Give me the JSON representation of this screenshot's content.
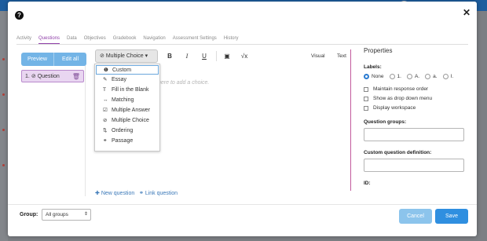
{
  "modal": {
    "tabs": [
      "Activity",
      "Questions",
      "Data",
      "Objectives",
      "Gradebook",
      "Navigation",
      "Assessment Settings",
      "History"
    ],
    "active_tab": "Questions"
  },
  "left": {
    "preview_label": "Preview",
    "edit_all_label": "Edit all",
    "question_item": "1.",
    "question_label": "Question"
  },
  "editor": {
    "type_select": "Multiple Choice",
    "placeholder": "here to add a choice.",
    "visual_label": "Visual",
    "text_label": "Text",
    "menu": [
      "Custom",
      "Essay",
      "Fill in the Blank",
      "Matching",
      "Multiple Answer",
      "Multiple Choice",
      "Ordering",
      "Passage"
    ],
    "new_question": "New question",
    "link_question": "Link question"
  },
  "properties": {
    "title": "Properties",
    "labels_title": "Labels:",
    "label_options": [
      "None",
      "1.",
      "A.",
      "a.",
      "I."
    ],
    "selected_label": "None",
    "checkboxes": [
      "Maintain response order",
      "Show as drop down menu",
      "Display workspace"
    ],
    "question_groups_title": "Question groups:",
    "custom_def_title": "Custom question definition:",
    "id_title": "ID:"
  },
  "footer": {
    "group_label": "Group:",
    "group_value": "All groups",
    "cancel_label": "Cancel",
    "save_label": "Save"
  },
  "colors": {
    "accent": "#8f3fa8",
    "primary": "#2f8fe0",
    "secondary": "#73b4e6"
  }
}
